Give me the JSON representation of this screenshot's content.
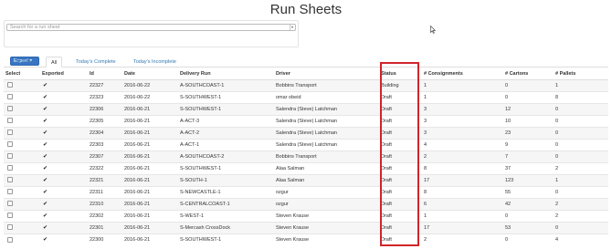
{
  "page": {
    "title": "Run Sheets"
  },
  "search": {
    "placeholder": "Search for a run sheet",
    "caret": "▾"
  },
  "toolbar": {
    "export_label": "Export ▾"
  },
  "tabs": [
    {
      "label": "▼ Filter"
    },
    {
      "label": "All"
    },
    {
      "label": "Today's Complete"
    },
    {
      "label": "Today's Incomplete"
    }
  ],
  "table": {
    "headers": [
      "Select",
      "Exported",
      "Id",
      "Date",
      "Delivery Run",
      "Driver",
      "Status",
      "# Consignments",
      "# Cartons",
      "# Pallets"
    ],
    "check_glyph": "✔",
    "rows": [
      {
        "id": "22327",
        "date": "2016-06-22",
        "run": "A-SOUTHCOAST-1",
        "driver": "Bobbins Transport",
        "status": "Building",
        "consignments": "1",
        "cartons": "0",
        "pallets": "1"
      },
      {
        "id": "22323",
        "date": "2016-06-22",
        "run": "S-SOUTHWEST-1",
        "driver": "omar obeid",
        "status": "Draft",
        "consignments": "1",
        "cartons": "0",
        "pallets": "8"
      },
      {
        "id": "22306",
        "date": "2016-06-21",
        "run": "S-SOUTHWEST-1",
        "driver": "Salendra (Steve) Latchman",
        "status": "Draft",
        "consignments": "3",
        "cartons": "12",
        "pallets": "0"
      },
      {
        "id": "22305",
        "date": "2016-06-21",
        "run": "A-ACT-3",
        "driver": "Salendra (Steve) Latchman",
        "status": "Draft",
        "consignments": "3",
        "cartons": "10",
        "pallets": "0"
      },
      {
        "id": "22304",
        "date": "2016-06-21",
        "run": "A-ACT-2",
        "driver": "Salendra (Steve) Latchman",
        "status": "Draft",
        "consignments": "3",
        "cartons": "23",
        "pallets": "0"
      },
      {
        "id": "22303",
        "date": "2016-06-21",
        "run": "A-ACT-1",
        "driver": "Salendra (Steve) Latchman",
        "status": "Draft",
        "consignments": "4",
        "cartons": "9",
        "pallets": "0"
      },
      {
        "id": "22307",
        "date": "2016-06-21",
        "run": "A-SOUTHCOAST-2",
        "driver": "Bobbins Transport",
        "status": "Draft",
        "consignments": "2",
        "cartons": "7",
        "pallets": "0"
      },
      {
        "id": "22322",
        "date": "2016-06-21",
        "run": "S-SOUTHWEST-1",
        "driver": "Alaa Salman",
        "status": "Draft",
        "consignments": "8",
        "cartons": "37",
        "pallets": "2"
      },
      {
        "id": "22321",
        "date": "2016-06-21",
        "run": "S-SOUTH-1",
        "driver": "Alaa Salman",
        "status": "Draft",
        "consignments": "17",
        "cartons": "123",
        "pallets": "1"
      },
      {
        "id": "22311",
        "date": "2016-06-21",
        "run": "S-NEWCASTLE-1",
        "driver": "ozgur",
        "status": "Draft",
        "consignments": "8",
        "cartons": "55",
        "pallets": "0"
      },
      {
        "id": "22310",
        "date": "2016-06-21",
        "run": "S-CENTRALCOAST-1",
        "driver": "ozgur",
        "status": "Draft",
        "consignments": "6",
        "cartons": "42",
        "pallets": "2"
      },
      {
        "id": "22302",
        "date": "2016-06-21",
        "run": "S-WEST-1",
        "driver": "Steven Krause",
        "status": "Draft",
        "consignments": "1",
        "cartons": "0",
        "pallets": "2"
      },
      {
        "id": "22301",
        "date": "2016-06-21",
        "run": "S-Mercash CrossDock",
        "driver": "Steven Krause",
        "status": "Draft",
        "consignments": "17",
        "cartons": "53",
        "pallets": "0"
      },
      {
        "id": "22300",
        "date": "2016-06-21",
        "run": "S-SOUTHWEST-1",
        "driver": "Steven Krause",
        "status": "Draft",
        "consignments": "2",
        "cartons": "0",
        "pallets": "4"
      }
    ]
  }
}
